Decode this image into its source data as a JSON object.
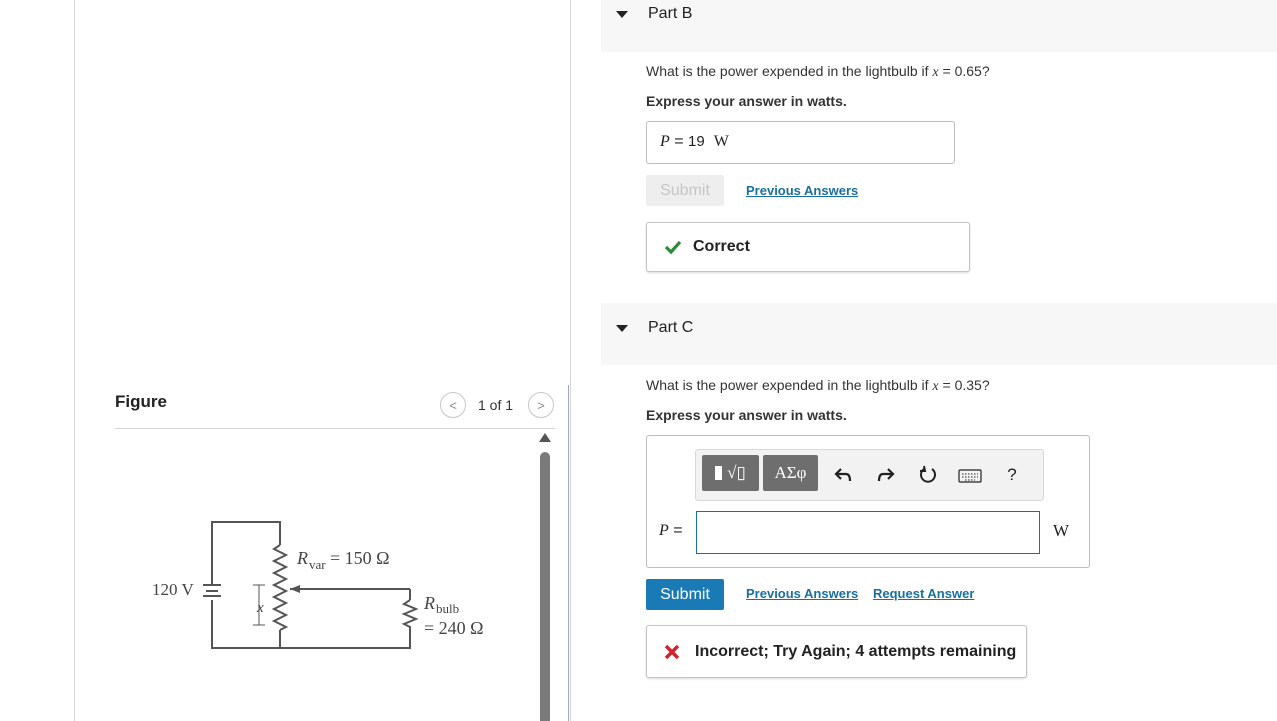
{
  "figure": {
    "title": "Figure",
    "pager": {
      "prev": "<",
      "label": "1 of 1",
      "next": ">"
    }
  },
  "circuit": {
    "battery_label": "120 V",
    "rvar_symbol": "R",
    "rvar_sub": "var",
    "rvar_value": " = 150 Ω",
    "x_label": "x",
    "rbulb_symbol": "R",
    "rbulb_sub": "bulb",
    "rbulb_value": "= 240 Ω"
  },
  "part_b": {
    "label": "Part B",
    "question_prefix": "What is the power expended in the lightbulb if ",
    "var": "x",
    "question_suffix": " = 0.65?",
    "express": "Express your answer in watts.",
    "answer_var": "P",
    "answer_eq": " = ",
    "answer_value": "19",
    "answer_unit": "W",
    "submit": "Submit",
    "previous_answers": "Previous Answers",
    "feedback": "Correct",
    "feedback_color": "#2e8b3a"
  },
  "part_c": {
    "label": "Part C",
    "question_prefix": "What is the power expended in the lightbulb if ",
    "var": "x",
    "question_suffix": " = 0.35?",
    "express": "Express your answer in watts.",
    "toolbar": {
      "templates": "√▯",
      "greek": "ΑΣφ",
      "help": "?"
    },
    "answer_var": "P",
    "answer_eq": " =",
    "answer_value": "",
    "answer_unit": "W",
    "submit": "Submit",
    "previous_answers": "Previous Answers",
    "request_answer": "Request Answer",
    "feedback": "Incorrect; Try Again; 4 attempts remaining",
    "feedback_color": "#d2232a"
  },
  "colors": {
    "accent": "#1a7ab6",
    "link": "#1a6f9e"
  }
}
